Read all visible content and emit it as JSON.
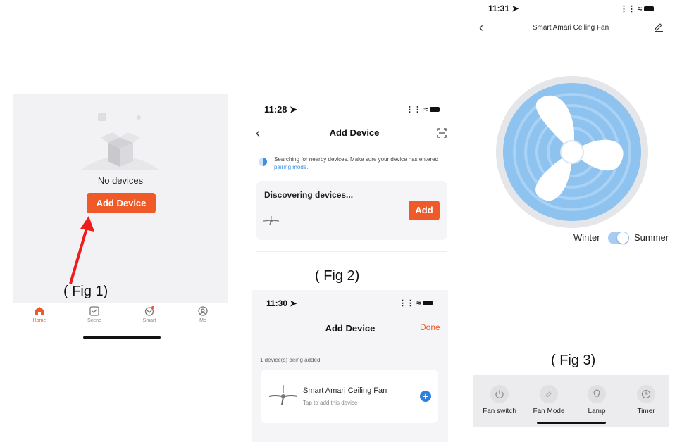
{
  "fig1": {
    "empty_text": "No devices",
    "add_button": "Add Device",
    "caption": "( Fig 1)",
    "tabs": [
      {
        "label": "Home",
        "icon": "home-icon",
        "active": true
      },
      {
        "label": "Scene",
        "icon": "scene-icon",
        "active": false
      },
      {
        "label": "Smart",
        "icon": "smart-icon",
        "active": false
      },
      {
        "label": "Me",
        "icon": "me-icon",
        "active": false
      }
    ],
    "accent_color": "#f05a28"
  },
  "fig2": {
    "status_time": "11:28",
    "title": "Add Device",
    "search_text": "Searching for nearby devices. Make sure your device has entered",
    "search_link": "pairing mode.",
    "discovering": "Discovering devices...",
    "add_button": "Add",
    "caption": "( Fig 2)"
  },
  "fig2b": {
    "status_time": "11:30",
    "title": "Add Device",
    "done": "Done",
    "being_added": "1 device(s) being added",
    "device_name": "Smart Amari Ceiling Fan",
    "device_sub": "Tap to add this device"
  },
  "fig3": {
    "status_time": "11:31",
    "title": "Smart Amari Ceiling Fan",
    "winter": "Winter",
    "summer": "Summer",
    "caption": "( Fig 3)",
    "season_mode": "Summer",
    "tools": [
      {
        "label": "Fan switch",
        "icon": "power-icon"
      },
      {
        "label": "Fan Mode",
        "icon": "fan-mode-icon"
      },
      {
        "label": "Lamp",
        "icon": "lamp-icon"
      },
      {
        "label": "Timer",
        "icon": "timer-icon"
      }
    ]
  }
}
